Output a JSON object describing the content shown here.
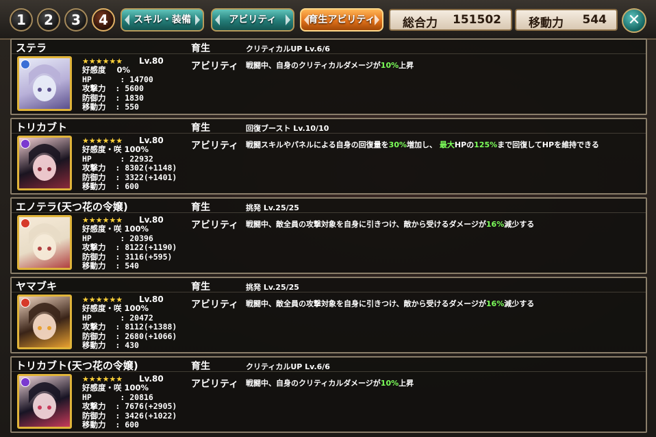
{
  "top_bar": {
    "page_buttons": [
      "1",
      "2",
      "3",
      "4"
    ],
    "active_page": "4",
    "tabs": [
      {
        "label": "スキル・装備",
        "color": "#2a8a84"
      },
      {
        "label": "アビリティ",
        "color": "#2a8a84"
      },
      {
        "label": "育生アビリティ",
        "color": "#e07a1e"
      }
    ],
    "total_power_label": "総合力",
    "total_power_value": "151502",
    "move_power_label": "移動力",
    "move_power_value": "544",
    "close_icon": "close-icon"
  },
  "labels": {
    "growth": "育生",
    "ability": "アビリティ",
    "affection": "好感度",
    "hp": "HP",
    "atk": "攻撃力",
    "def": "防御力",
    "move": "移動力"
  },
  "characters": [
    {
      "name": "ステラ",
      "element_color": "#3b6fd6",
      "stars": "★★★★★★",
      "level": "Lv.80",
      "affection": "好感度    0%",
      "hp": "HP      : 14700",
      "atk": "攻撃力  : 5600",
      "def": "防御力  : 1830",
      "move": "移動力  : 550",
      "skill": "クリティカルUP Lv.6/6",
      "desc_pre": "戦闘中、自身のクリティカルダメージが",
      "desc_hl": "10%",
      "desc_post": "上昇",
      "portrait_colors": [
        "#e8ecf8",
        "#b8b0d8",
        "#5a4f8c"
      ]
    },
    {
      "name": "トリカブト",
      "element_color": "#7a3ad0",
      "stars": "★★★★★★",
      "level": "Lv.80",
      "affection": "好感度・咲 100%",
      "hp": "HP      : 22932",
      "atk": "攻撃力  : 8302(+1148)",
      "def": "防御力  : 3322(+1401)",
      "move": "移動力  : 600",
      "skill": "回復ブースト Lv.10/10",
      "desc_pre": "戦闘スキルやパネルによる自身の回復量を",
      "desc_hl": "30%",
      "desc_post": "増加し、",
      "desc_hl2": "最大",
      "desc_mid": "HPの",
      "desc_hl3": "125%",
      "desc_post2": "まで回復してHPを維持できる",
      "portrait_colors": [
        "#f4d0d4",
        "#1a1420",
        "#8a2a3a"
      ]
    },
    {
      "name": "エノテラ(天つ花の令嬢)",
      "element_color": "#d63a2a",
      "stars": "★★★★★★",
      "level": "Lv.80",
      "affection": "好感度・咲 100%",
      "hp": "HP      : 20396",
      "atk": "攻撃力  : 8122(+1190)",
      "def": "防御力  : 3116(+595)",
      "move": "移動力  : 540",
      "skill": "挑発 Lv.25/25",
      "desc_pre": "戦闘中、敵全員の攻撃対象を自身に引きつけ、敵から受けるダメージが",
      "desc_hl": "16%",
      "desc_post": "減少する",
      "portrait_colors": [
        "#f6ead8",
        "#e8dcc6",
        "#b04040"
      ]
    },
    {
      "name": "ヤマブキ",
      "element_color": "#d63a2a",
      "stars": "★★★★★★",
      "level": "Lv.80",
      "affection": "好感度・咲 100%",
      "hp": "HP      : 20472",
      "atk": "攻撃力  : 8112(+1388)",
      "def": "防御力  : 2680(+1066)",
      "move": "移動力  : 430",
      "skill": "挑発 Lv.25/25",
      "desc_pre": "戦闘中、敵全員の攻撃対象を自身に引きつけ、敵から受けるダメージが",
      "desc_hl": "16%",
      "desc_post": "減少する",
      "portrait_colors": [
        "#f2d6c2",
        "#3a2418",
        "#e8a030"
      ]
    },
    {
      "name": "トリカブト(天つ花の令嬢)",
      "element_color": "#7a3ad0",
      "stars": "★★★★★★",
      "level": "Lv.80",
      "affection": "好感度・咲 100%",
      "hp": "HP      : 20816",
      "atk": "攻撃力  : 7676(+2905)",
      "def": "防御力  : 3426(+1022)",
      "move": "移動力  : 600",
      "skill": "クリティカルUP Lv.6/6",
      "desc_pre": "戦闘中、自身のクリティカルダメージが",
      "desc_hl": "10%",
      "desc_post": "上昇",
      "portrait_colors": [
        "#f0d4d8",
        "#181424",
        "#c83a5a"
      ]
    }
  ]
}
